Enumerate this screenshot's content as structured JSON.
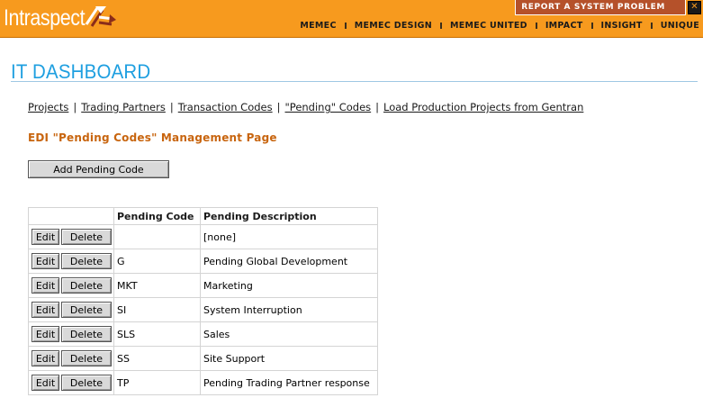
{
  "header": {
    "logo_text": "Intraspect",
    "report_label": "REPORT A SYSTEM PROBLEM",
    "report_close": "✕",
    "nav": [
      "MEMEC",
      "MEMEC DESIGN",
      "MEMEC UNITED",
      "IMPACT",
      "INSIGHT",
      "UNIQUE"
    ]
  },
  "colors": {
    "brand_orange": "#f79a1e",
    "title_blue": "#1e9fe0",
    "section_orange": "#c8650f"
  },
  "page": {
    "title": "IT DASHBOARD",
    "links": [
      "Projects",
      "Trading Partners",
      "Transaction Codes",
      "\"Pending\" Codes",
      "Load Production Projects from Gentran"
    ],
    "link_separator": "|",
    "section_title": "EDI \"Pending Codes\" Management Page",
    "add_button": "Add Pending Code"
  },
  "table": {
    "headers": [
      "",
      "Pending Code",
      "Pending Description"
    ],
    "edit_label": "Edit",
    "delete_label": "Delete",
    "rows": [
      {
        "code": "",
        "description": "[none]"
      },
      {
        "code": "G",
        "description": "Pending Global Development"
      },
      {
        "code": "MKT",
        "description": "Marketing"
      },
      {
        "code": "SI",
        "description": "System Interruption"
      },
      {
        "code": "SLS",
        "description": "Sales"
      },
      {
        "code": "SS",
        "description": "Site Support"
      },
      {
        "code": "TP",
        "description": "Pending Trading Partner response"
      }
    ]
  }
}
